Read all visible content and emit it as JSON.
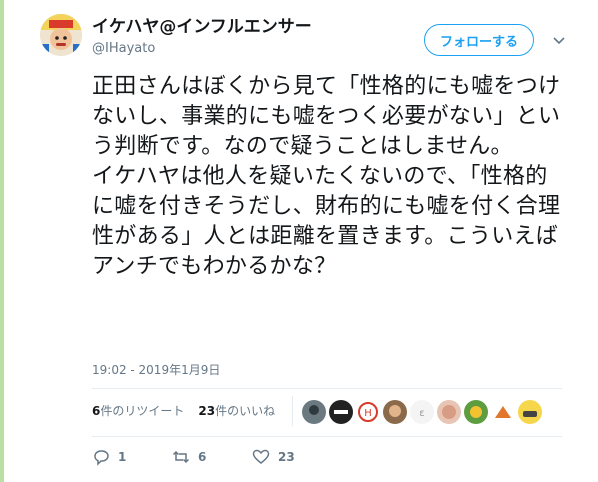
{
  "author": {
    "name": "イケハヤ@インフルエンサー",
    "handle": "@IHayato"
  },
  "follow_label": "フォローする",
  "tweet_text": "正田さんはぼくから見て「性格的にも嘘をつけないし、事業的にも嘘をつく必要がない」という判断です。なので疑うことはしません。\nイケハヤは他人を疑いたくないので、「性格的に嘘を付きそうだし、財布的にも嘘を付く合理性がある」人とは距離を置きます。こういえばアンチでもわかるかな？",
  "timestamp": "19:02 - 2019年1月9日",
  "stats": {
    "retweets_count": "6",
    "retweets_label": "件のリツイート",
    "likes_count": "23",
    "likes_label": "件のいいね"
  },
  "actions": {
    "reply_count": "1",
    "retweet_count": "6",
    "like_count": "23"
  },
  "icons": [
    "caret-down-icon",
    "reply-icon",
    "retweet-icon",
    "heart-icon"
  ],
  "colors": {
    "accent": "#1da1f2",
    "secondary_text": "#657786",
    "left_bar": "#b9dfa4"
  }
}
